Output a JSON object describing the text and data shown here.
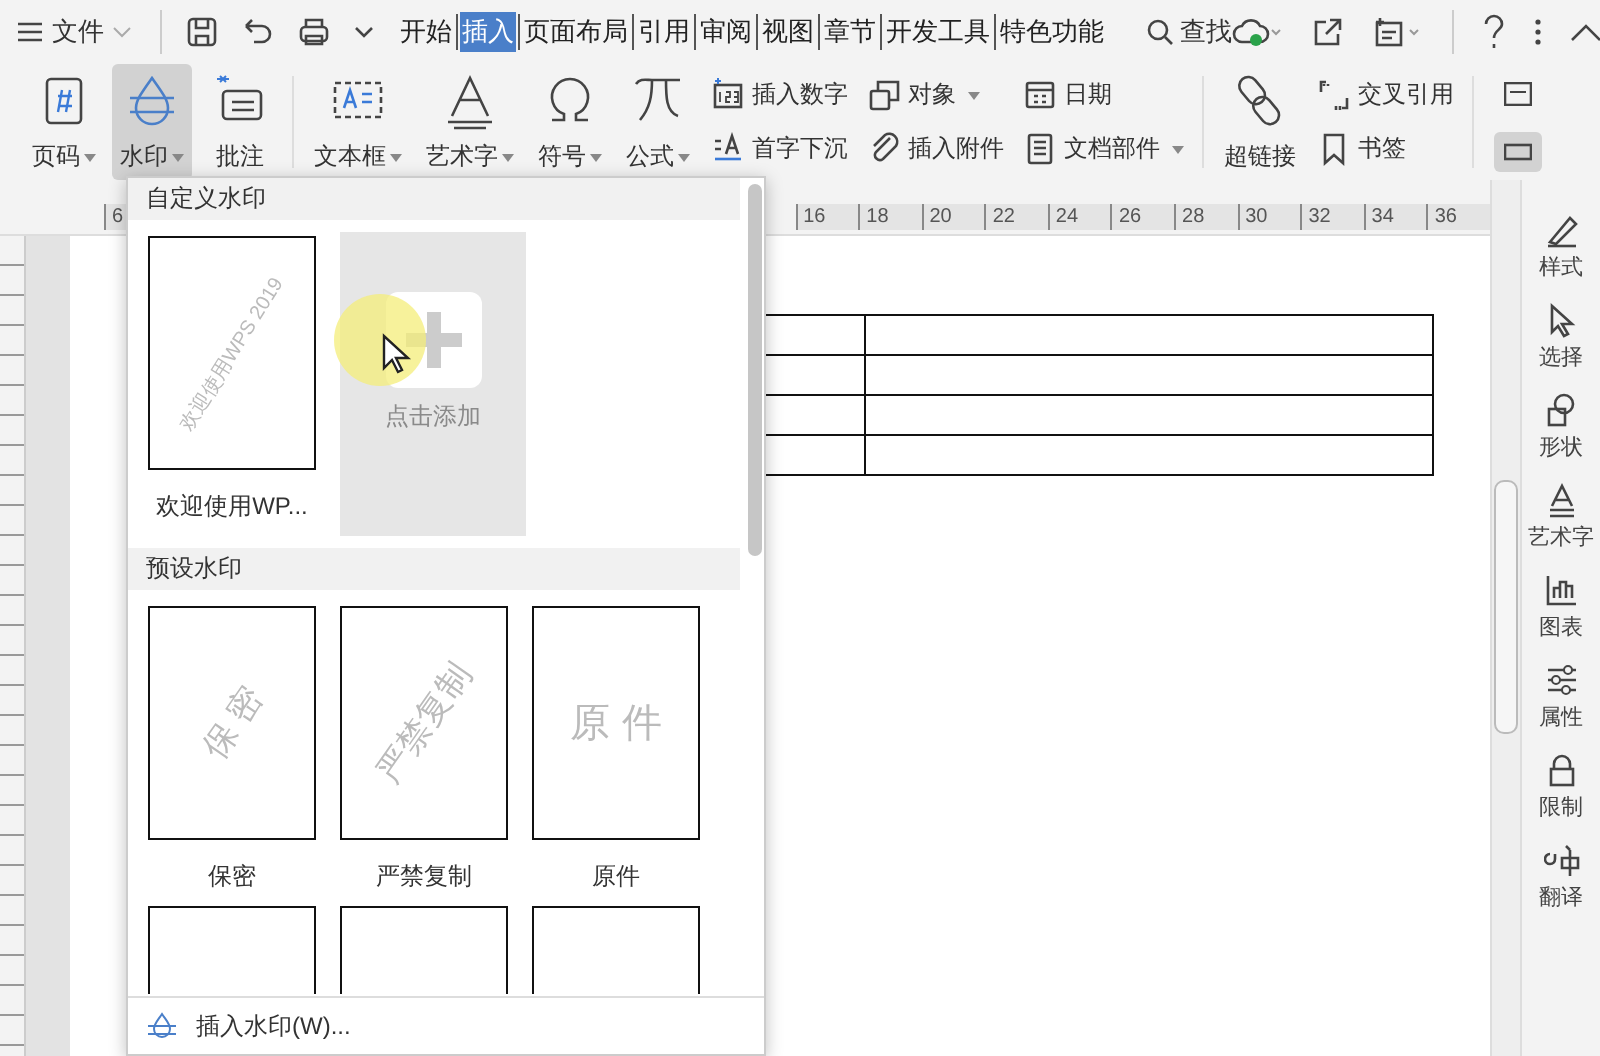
{
  "menu_bar": {
    "file_label": "文件",
    "tabs": [
      {
        "label": "开始",
        "selected": false
      },
      {
        "label": "插入",
        "selected": true
      },
      {
        "label": "页面布局",
        "selected": false
      },
      {
        "label": "引用",
        "selected": false
      },
      {
        "label": "审阅",
        "selected": false
      },
      {
        "label": "视图",
        "selected": false
      },
      {
        "label": "章节",
        "selected": false
      },
      {
        "label": "开发工具",
        "selected": false
      },
      {
        "label": "特色功能",
        "selected": false
      }
    ],
    "search_label": "查找"
  },
  "ribbon": {
    "sections": [
      {
        "items": [
          {
            "kind": "large",
            "label": "页码",
            "dropdown": true,
            "selected": false
          },
          {
            "kind": "large",
            "label": "水印",
            "dropdown": true,
            "selected": true
          },
          {
            "kind": "large",
            "label": "批注",
            "dropdown": false,
            "selected": false
          }
        ]
      },
      {
        "items": [
          {
            "kind": "large",
            "label": "文本框",
            "dropdown": true,
            "selected": false
          },
          {
            "kind": "large",
            "label": "艺术字",
            "dropdown": true,
            "selected": false
          },
          {
            "kind": "large",
            "label": "符号",
            "dropdown": true,
            "selected": false
          },
          {
            "kind": "large",
            "label": "公式",
            "dropdown": true,
            "selected": false
          },
          {
            "kind": "stack",
            "items": [
              {
                "label": "插入数字",
                "dropdown": false
              },
              {
                "label": "首字下沉",
                "dropdown": false
              }
            ]
          },
          {
            "kind": "stack",
            "items": [
              {
                "label": "对象",
                "dropdown": true
              },
              {
                "label": "插入附件",
                "dropdown": false
              }
            ]
          },
          {
            "kind": "stack",
            "items": [
              {
                "label": "日期",
                "dropdown": false
              },
              {
                "label": "文档部件",
                "dropdown": true
              }
            ]
          }
        ]
      },
      {
        "items": [
          {
            "kind": "large",
            "label": "超链接",
            "dropdown": false,
            "selected": false
          },
          {
            "kind": "stack",
            "items": [
              {
                "label": "交叉引用",
                "dropdown": false
              },
              {
                "label": "书签",
                "dropdown": false
              }
            ]
          }
        ]
      }
    ],
    "layout_toggles": [
      {
        "selected": false
      },
      {
        "selected": true
      }
    ]
  },
  "ruler": {
    "labels": [
      "6",
      "16",
      "18",
      "20",
      "22",
      "24",
      "26",
      "28",
      "30",
      "32",
      "34",
      "36"
    ]
  },
  "watermark_menu": {
    "sections": [
      {
        "title": "自定义水印",
        "items": [
          {
            "kind": "custom",
            "preview_text": "欢迎使用WPS 2019",
            "label": "欢迎使用WP..."
          },
          {
            "kind": "add",
            "label": "点击添加"
          }
        ]
      },
      {
        "title": "预设水印",
        "items": [
          {
            "kind": "preset",
            "preview_text": "保 密",
            "rotated": true,
            "label": "保密"
          },
          {
            "kind": "preset",
            "preview_text": "严禁复制",
            "rotated": true,
            "label": "严禁复制"
          },
          {
            "kind": "preset",
            "preview_text": "原 件",
            "rotated": false,
            "label": "原件"
          },
          {
            "kind": "partial"
          },
          {
            "kind": "partial"
          },
          {
            "kind": "partial"
          }
        ]
      }
    ],
    "footer_label": "插入水印(W)..."
  },
  "side_panel": {
    "items": [
      "样式",
      "选择",
      "形状",
      "艺术字",
      "图表",
      "属性",
      "限制",
      "翻译"
    ]
  }
}
